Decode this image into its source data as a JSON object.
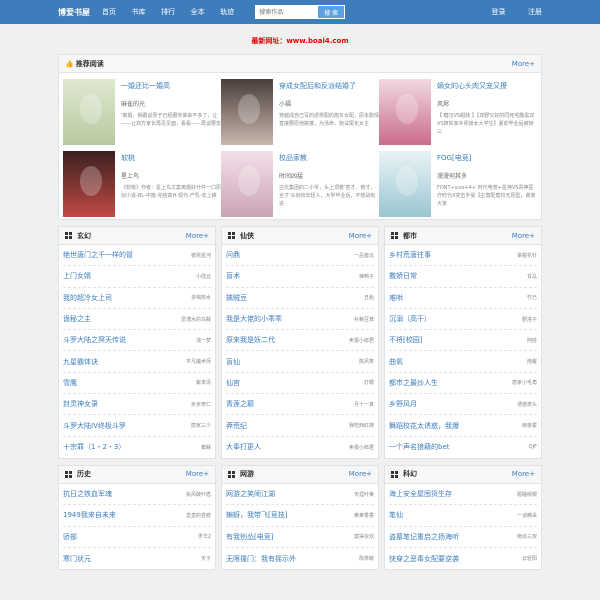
{
  "header": {
    "logo": "博爱书屋",
    "nav": [
      "首页",
      "书库",
      "排行",
      "全本",
      "轨迹"
    ],
    "search_placeholder": "搜索作品",
    "search_button": "搜 索",
    "login": "登录",
    "register": "注册"
  },
  "notice": "最新网址：www.boai4.com",
  "recommend": {
    "title": "推荐阅读",
    "more": "More+",
    "items": [
      {
        "title": "一婚还比一婚高",
        "author": "麻雀的光",
        "desc": "'离婚，我跟说厚于已经跟你谁来不多了，让——让双方家长再见见面，看看——再谈要去",
        "colors": [
          "#dfe8d2",
          "#b8c9a0"
        ]
      },
      {
        "title": "穿成女配后和反派结婚了",
        "author": "小福",
        "desc": "穿越成自己写的虐男配的炮灰女配，原本剧情直接要原他挨揍，为活命，她试尾化女主",
        "colors": [
          "#4a3e3a",
          "#c9b7ad"
        ]
      },
      {
        "title": "嫡女的心头肉又宠又撩",
        "author": "风烬",
        "desc": "【 糖汉VS甜妹 】【双野又好的同死宅腹黑双VS撩贫家乡师妹女大学生】夏却毕业后被转三",
        "colors": [
          "#f2d9e3",
          "#c96b8d"
        ]
      },
      {
        "title": "软桃",
        "author": "星上鸟",
        "desc": "《软桃》作者：星上鸟文案离婚好什件一口原创小说-BL-中篇-完结高H-现代-产乳-年上耕",
        "colors": [
          "#3a2020",
          "#c14a45"
        ]
      },
      {
        "title": "校品家教",
        "author": "时间凶猛",
        "desc": "古氏集团的二小爷，头上顶着'苍才、奇才、全才'头衔的年轻人，大学毕业后，不想战有进",
        "colors": [
          "#f3e0e8",
          "#caa3b6"
        ]
      },
      {
        "title": "FOG[电竞]",
        "author": "漫漫何其多",
        "desc": "FONT+size+4+ 时代电竞+星神VS青神医疗时代X突击手受【主角配角均无原型，谢谢大家",
        "colors": [
          "#e9f3f6",
          "#9bc6d2"
        ]
      }
    ]
  },
  "categories": [
    {
      "title": "玄幻",
      "more": "More+",
      "items": [
        {
          "t": "绝世唐门之千一样的冒",
          "a": "彼昆星河"
        },
        {
          "t": "上门女婿",
          "a": "小陆云"
        },
        {
          "t": "我的超冷女上司",
          "a": "多喝热水"
        },
        {
          "t": "诡秘之主",
          "a": "爱潜水的乌贼"
        },
        {
          "t": "斗罗大陆之冥天传说",
          "a": "浅一梦"
        },
        {
          "t": "九星霸体诀",
          "a": "平凡魔术师"
        },
        {
          "t": "雪鹰",
          "a": "紫未清"
        },
        {
          "t": "封灵神女录",
          "a": "步步奇仁"
        },
        {
          "t": "斗罗大陆IV终极斗罗",
          "a": "唐家三少"
        },
        {
          "t": "十宗罪（1・2・3）",
          "a": "蜘蛛"
        }
      ]
    },
    {
      "title": "仙侠",
      "more": "More+",
      "items": [
        {
          "t": "问鼎",
          "a": "一品蜜瓜"
        },
        {
          "t": "盲术",
          "a": "辣鸭子"
        },
        {
          "t": "擒贼豆",
          "a": "丑蛤"
        },
        {
          "t": "我是大佬的小乖乖",
          "a": "补粮豆茸"
        },
        {
          "t": "原来我是妖二代",
          "a": "卖报小郎君"
        },
        {
          "t": "盲仙",
          "a": "陈风笑"
        },
        {
          "t": "仙官",
          "a": "打眼"
        },
        {
          "t": "青莲之巅",
          "a": "月十一真"
        },
        {
          "t": "莽荒纪",
          "a": "我吃西红柿"
        },
        {
          "t": "大奉打更人",
          "a": "卖报小郎君"
        }
      ]
    },
    {
      "title": "都市",
      "more": "More+",
      "items": [
        {
          "t": "乡村荒唐往事",
          "a": "掌握花针"
        },
        {
          "t": "撒娇日常",
          "a": "甘乩"
        },
        {
          "t": "难哄",
          "a": "竹已"
        },
        {
          "t": "沉溺（高干）",
          "a": "剧洛子"
        },
        {
          "t": "不将[校园]",
          "a": "阿娃"
        },
        {
          "t": "曲氧",
          "a": "南羅"
        },
        {
          "t": "都市之最炒人生",
          "a": "唐家小毛角"
        },
        {
          "t": "乡野风月",
          "a": "诱惑奇头"
        },
        {
          "t": "舞蹈校花太诱惑，我爆",
          "a": "雨夜霍"
        },
        {
          "t": "一个声名狼藉的bet",
          "a": "QJF"
        }
      ]
    },
    {
      "title": "历史",
      "more": "More+",
      "items": [
        {
          "t": "抗日之铁血军魂",
          "a": "执风破叶盾"
        },
        {
          "t": "1949我来自未来",
          "a": "堂皇的苍痕"
        },
        {
          "t": "骄部",
          "a": "矛华2"
        },
        {
          "t": "寒门状元",
          "a": "天子"
        }
      ]
    },
    {
      "title": "网游",
      "more": "More+",
      "items": [
        {
          "t": "网游之笑闹江湖",
          "a": "天涯叶莱"
        },
        {
          "t": "蝙蚜，我带飞[竞技]",
          "a": "莱莱香香"
        },
        {
          "t": "有我别怂[电竞]",
          "a": "莫得永欢"
        },
        {
          "t": "无限撞门：我有摇示外",
          "a": "陈俳猷"
        }
      ]
    },
    {
      "title": "科幻",
      "more": "More+",
      "items": [
        {
          "t": "海上安全屋囤货生存",
          "a": "题睡候艰"
        },
        {
          "t": "笔仙",
          "a": "一谈精采"
        },
        {
          "t": "盗墓笔记重启之扬海听",
          "a": "南派三叔"
        },
        {
          "t": "快穿之恶毒女配要逆袭",
          "a": "云轻阳"
        }
      ]
    }
  ]
}
